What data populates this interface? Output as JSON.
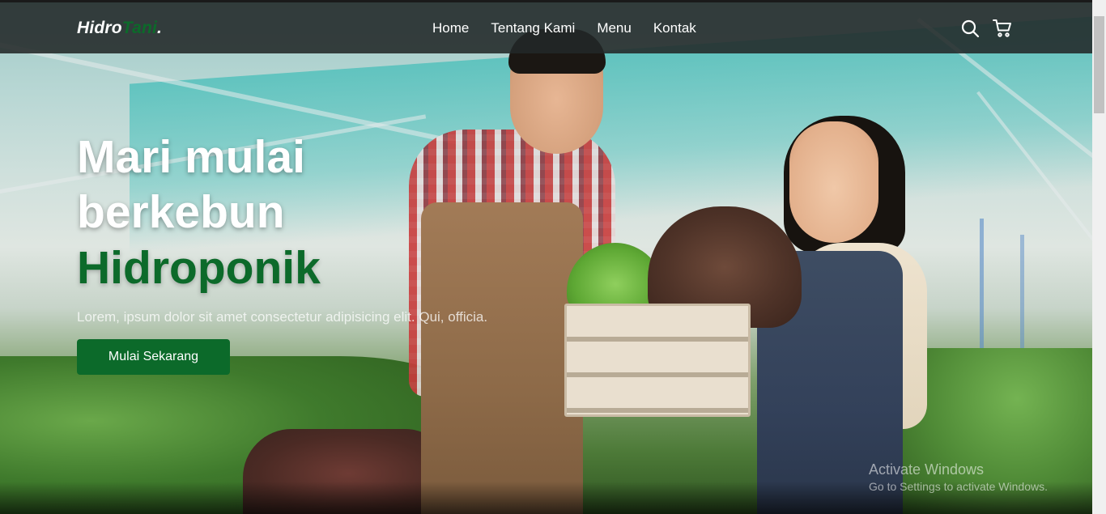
{
  "brand": {
    "part1": "Hidro",
    "part2": "Tani",
    "part3": ".",
    "accent_color": "#0c6a2a"
  },
  "nav": {
    "items": [
      {
        "label": "Home"
      },
      {
        "label": "Tentang Kami"
      },
      {
        "label": "Menu"
      },
      {
        "label": "Kontak"
      }
    ],
    "icons": [
      "search-icon",
      "cart-icon"
    ]
  },
  "hero": {
    "title_line1": "Mari mulai",
    "title_line2": "berkebun",
    "title_accent": "Hidroponik",
    "description": "Lorem, ipsum dolor sit amet consectetur adipisicing elit. Qui, officia.",
    "cta_label": "Mulai Sekarang"
  },
  "watermark": {
    "title": "Activate Windows",
    "subtitle": "Go to Settings to activate Windows."
  }
}
